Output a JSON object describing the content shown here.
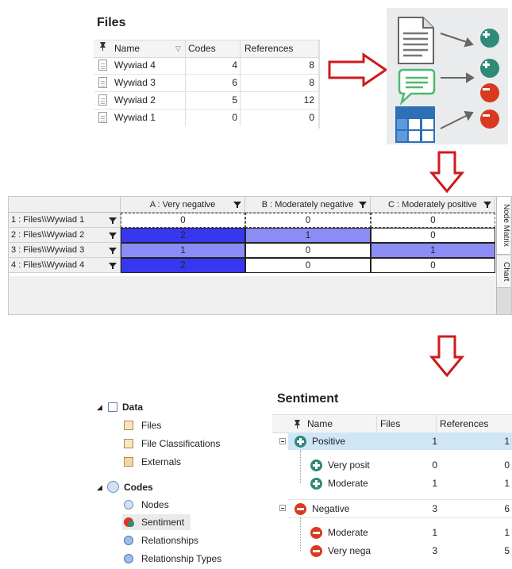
{
  "files_panel": {
    "title": "Files",
    "columns": [
      "Name",
      "Codes",
      "References"
    ],
    "rows": [
      {
        "name": "Wywiad 4",
        "codes": "4",
        "refs": "8"
      },
      {
        "name": "Wywiad 3",
        "codes": "6",
        "refs": "8"
      },
      {
        "name": "Wywiad 2",
        "codes": "5",
        "refs": "12"
      },
      {
        "name": "Wywiad 1",
        "codes": "0",
        "refs": "0"
      }
    ]
  },
  "icon_panel": {
    "icons": [
      "document-icon",
      "memo-icon",
      "table-icon"
    ],
    "results": [
      "plus",
      "plus",
      "minus",
      "minus"
    ]
  },
  "matrix": {
    "columns": [
      "A : Very negative",
      "B : Moderately negative",
      "C : Moderately positive"
    ],
    "rows": [
      {
        "label": "1 : Files\\\\Wywiad 1",
        "values": [
          "0",
          "0",
          "0"
        ]
      },
      {
        "label": "2 : Files\\\\Wywiad 2",
        "values": [
          "2",
          "1",
          "0"
        ]
      },
      {
        "label": "3 : Files\\\\Wywiad 3",
        "values": [
          "1",
          "0",
          "1"
        ]
      },
      {
        "label": "4 : Files\\\\Wywiad 4",
        "values": [
          "2",
          "0",
          "0"
        ]
      }
    ],
    "side_tabs": [
      "Node Matrix",
      "Chart"
    ],
    "colors": {
      "high": "#3737f0",
      "mid": "#8c8cf5",
      "none": "#ffffff"
    }
  },
  "tree": {
    "data_label": "Data",
    "data_items": [
      "Files",
      "File Classifications",
      "Externals"
    ],
    "codes_label": "Codes",
    "codes_items": [
      "Nodes",
      "Sentiment",
      "Relationships",
      "Relationship Types"
    ]
  },
  "sentiment": {
    "title": "Sentiment",
    "columns": [
      "Name",
      "Files",
      "References"
    ],
    "positive": {
      "label": "Positive",
      "files": "1",
      "refs": "1"
    },
    "positive_children": [
      {
        "label": "Very posit",
        "files": "0",
        "refs": "0"
      },
      {
        "label": "Moderate",
        "files": "1",
        "refs": "1"
      }
    ],
    "negative": {
      "label": "Negative",
      "files": "3",
      "refs": "6"
    },
    "negative_children": [
      {
        "label": "Moderate",
        "files": "1",
        "refs": "1"
      },
      {
        "label": "Very nega",
        "files": "3",
        "refs": "5"
      }
    ],
    "colors": {
      "positive": "#2f8a78",
      "negative": "#d8391f",
      "selected": "#cfe6f7"
    }
  },
  "arrow_color": "#d0191c"
}
